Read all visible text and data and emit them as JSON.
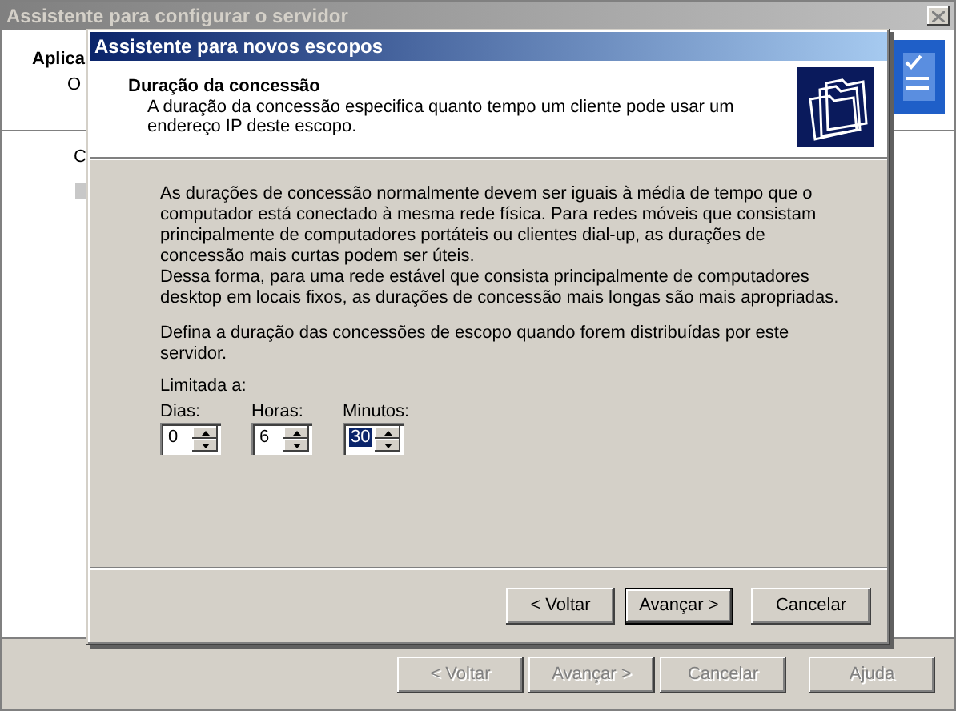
{
  "background_window": {
    "title": "Assistente para configurar o servidor",
    "heading": "Aplica",
    "line_1": "O",
    "line_2": "C",
    "buttons": [
      {
        "label": "< Voltar",
        "disabled": true
      },
      {
        "label": "Avançar >",
        "disabled": true
      },
      {
        "label": "Cancelar",
        "disabled": true
      },
      {
        "label": "Ajuda",
        "disabled": true
      }
    ]
  },
  "dialog": {
    "title": "Assistente para novos escopos",
    "header": {
      "title": "Duração da concessão",
      "subtitle": "A duração da concessão especifica quanto tempo um cliente pode usar um endereço IP deste escopo."
    },
    "paragraph_groups": [
      [
        "As durações de concessão normalmente devem ser iguais à média de tempo que o computador está conectado à mesma rede física. Para redes móveis que consistam principalmente de computadores portáteis ou clientes dial-up, as durações de concessão mais curtas podem ser úteis.",
        "Dessa forma, para uma rede estável que consista principalmente de computadores desktop em locais fixos, as durações de concessão mais longas são mais apropriadas."
      ],
      [
        "Defina a duração das concessões de escopo quando forem distribuídas por este servidor."
      ]
    ],
    "group_label": "Limitada a:",
    "spinners": [
      {
        "label": "Dias:",
        "value": "0",
        "selected": false
      },
      {
        "label": "Horas:",
        "value": "6",
        "selected": false
      },
      {
        "label": "Minutos:",
        "value": "30",
        "selected": true
      }
    ],
    "buttons": [
      {
        "label": "< Voltar",
        "default": false
      },
      {
        "label": "Avançar >",
        "default": true
      },
      {
        "label": "Cancelar",
        "default": false
      }
    ]
  }
}
